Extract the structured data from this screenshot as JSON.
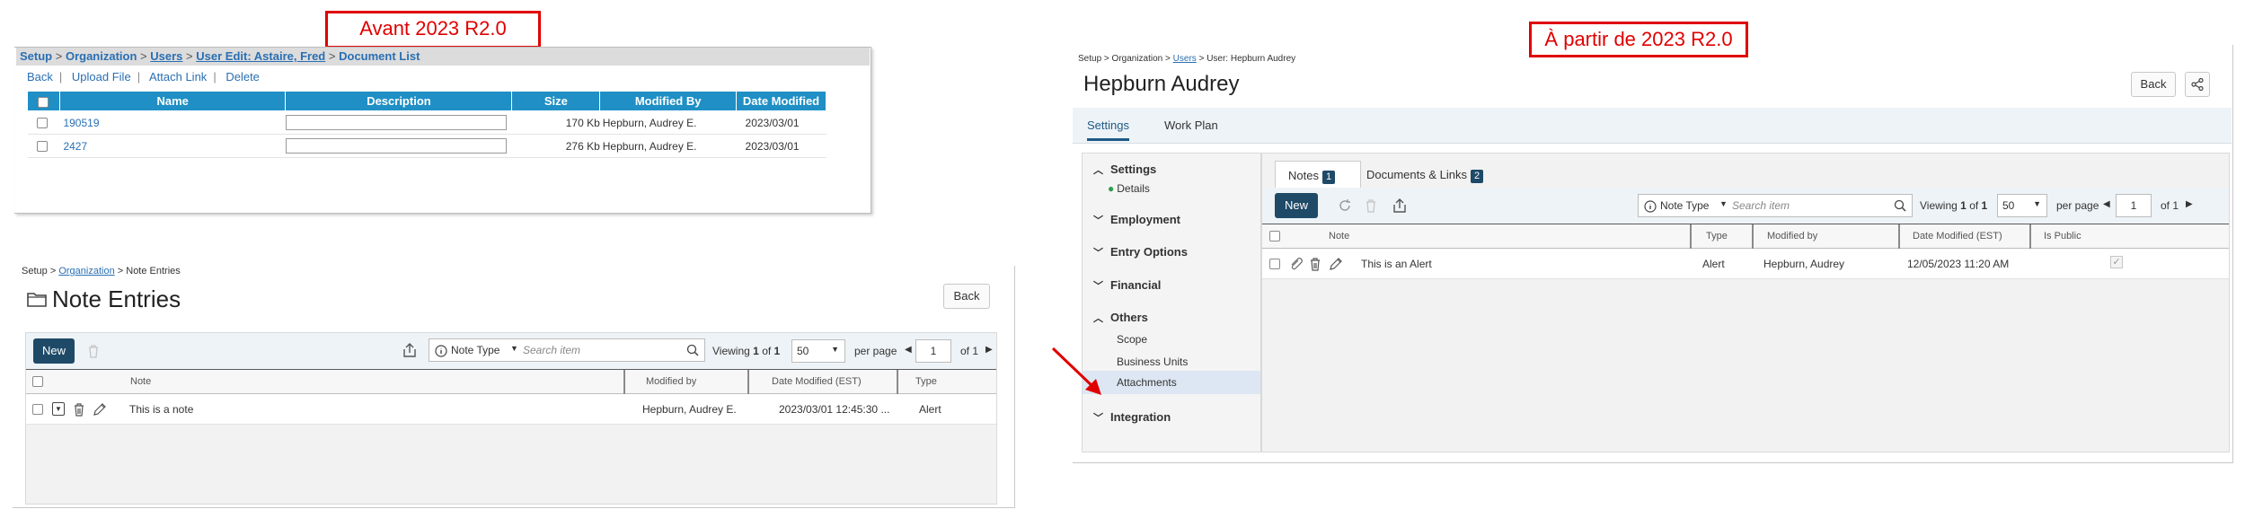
{
  "labels": {
    "before": "Avant 2023 R2.0",
    "after": "À partir de 2023 R2.0"
  },
  "old_document_list": {
    "breadcrumb": [
      "Setup",
      "Organization",
      "Users",
      "User Edit: Astaire, Fred",
      "Document List"
    ],
    "breadcrumb_sep": ">",
    "actions": [
      "Back",
      "Upload File",
      "Attach Link",
      "Delete"
    ],
    "columns": [
      "Name",
      "Description",
      "Size",
      "Modified By",
      "Date Modified"
    ],
    "rows": [
      {
        "name": "190519",
        "size": "170 Kb",
        "modified_by": "Hepburn, Audrey E.",
        "date": "2023/03/01"
      },
      {
        "name": "2427",
        "size": "276 Kb",
        "modified_by": "Hepburn, Audrey E.",
        "date": "2023/03/01"
      }
    ]
  },
  "old_note_entries": {
    "breadcrumb": {
      "a": "Setup",
      "b": "Organization",
      "c": "Note Entries",
      "sep": ">"
    },
    "title": "Note Entries",
    "back_label": "Back",
    "new_label": "New",
    "note_type_label": "Note Type",
    "search_placeholder": "Search item",
    "viewing_label": "Viewing",
    "viewing_from": "1",
    "of_label": "of",
    "viewing_to": "1",
    "page_size": "50",
    "per_page_label": "per page",
    "page": "1",
    "page_of": "of 1",
    "columns": [
      "Note",
      "Modified by",
      "Date Modified (EST)",
      "Type"
    ],
    "row": {
      "note": "This is a note",
      "modified_by": "Hepburn, Audrey E.",
      "date": "2023/03/01 12:45:30 ...",
      "type": "Alert"
    }
  },
  "new_ui": {
    "breadcrumb": {
      "a": "Setup",
      "b": "Organization",
      "c": "Users",
      "d": "User: Hepburn Audrey",
      "sep": ">"
    },
    "title": "Hepburn Audrey",
    "back_label": "Back",
    "top_tabs": [
      "Settings",
      "Work Plan"
    ],
    "sidebar": {
      "settings": "Settings",
      "details": "Details",
      "employment": "Employment",
      "entry_options": "Entry Options",
      "financial": "Financial",
      "others": "Others",
      "scope": "Scope",
      "business_units": "Business Units",
      "attachments": "Attachments",
      "integration": "Integration"
    },
    "inner_tabs": [
      {
        "label": "Notes",
        "count": "1"
      },
      {
        "label": "Documents & Links",
        "count": "2"
      }
    ],
    "new_label": "New",
    "note_type_label": "Note Type",
    "search_placeholder": "Search item",
    "viewing_label": "Viewing",
    "viewing_from": "1",
    "of_label": "of",
    "viewing_to": "1",
    "page_size": "50",
    "per_page_label": "per page",
    "page": "1",
    "page_of": "of 1",
    "columns": [
      "Note",
      "Type",
      "Modified by",
      "Date Modified (EST)",
      "Is Public"
    ],
    "row": {
      "note": "This is an Alert",
      "type": "Alert",
      "modified_by": "Hepburn, Audrey",
      "date": "12/05/2023 11:20 AM"
    }
  }
}
